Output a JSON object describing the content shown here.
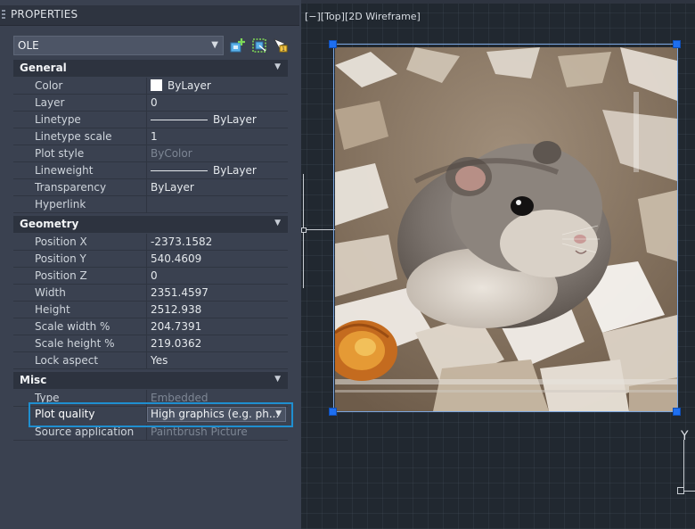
{
  "palette": {
    "title": "PROPERTIES",
    "object_type": "OLE",
    "toolbar_icons": [
      "quick-select-icon",
      "select-objects-icon",
      "toggle-pickadd-icon"
    ],
    "categories": {
      "general": {
        "label": "General",
        "rows": [
          {
            "name": "Color",
            "value": "ByLayer"
          },
          {
            "name": "Layer",
            "value": "0"
          },
          {
            "name": "Linetype",
            "value": "ByLayer"
          },
          {
            "name": "Linetype scale",
            "value": "1"
          },
          {
            "name": "Plot style",
            "value": "ByColor"
          },
          {
            "name": "Lineweight",
            "value": "ByLayer"
          },
          {
            "name": "Transparency",
            "value": "ByLayer"
          },
          {
            "name": "Hyperlink",
            "value": ""
          }
        ]
      },
      "geometry": {
        "label": "Geometry",
        "rows": [
          {
            "name": "Position X",
            "value": "-2373.1582"
          },
          {
            "name": "Position Y",
            "value": "540.4609"
          },
          {
            "name": "Position Z",
            "value": "0"
          },
          {
            "name": "Width",
            "value": "2351.4597"
          },
          {
            "name": "Height",
            "value": "2512.938"
          },
          {
            "name": "Scale width  %",
            "value": "204.7391"
          },
          {
            "name": "Scale height %",
            "value": "219.0362"
          },
          {
            "name": "Lock aspect",
            "value": "Yes"
          }
        ]
      },
      "misc": {
        "label": "Misc",
        "rows": [
          {
            "name": "Type",
            "value": "Embedded"
          },
          {
            "name": "Plot quality",
            "value": "High  graphics  (e.g.  ph..."
          },
          {
            "name": "Source application",
            "value": "Paintbrush Picture"
          }
        ]
      }
    }
  },
  "viewport": {
    "label": "[−][Top][2D Wireframe]",
    "ucs_y_label": "Y"
  },
  "colors": {
    "selection_highlight": "#1f8fd0",
    "grip": "#1e6ff0",
    "palette_bg": "#3a4150",
    "viewport_bg": "#212830"
  }
}
